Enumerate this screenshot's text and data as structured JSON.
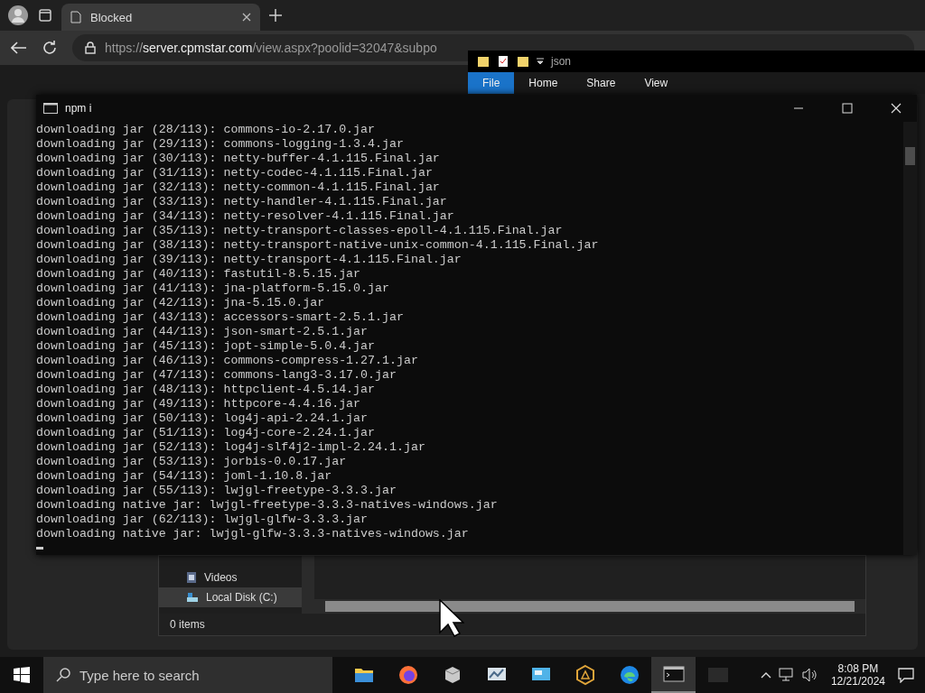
{
  "browser": {
    "tab": {
      "title": "Blocked",
      "selected": true
    },
    "url": {
      "scheme": "https://",
      "host": "server.cpmstar.com",
      "path": "/view.aspx?poolid=32047&subpo"
    }
  },
  "explorer": {
    "path": "json",
    "ribbon_tabs": [
      {
        "label": "File",
        "selected": true
      },
      {
        "label": "Home",
        "selected": false
      },
      {
        "label": "Share",
        "selected": false
      },
      {
        "label": "View",
        "selected": false
      }
    ],
    "nav_items": [
      {
        "label": "Videos",
        "kind": "videos",
        "selected": false
      },
      {
        "label": "Local Disk (C:)",
        "kind": "disk",
        "selected": true
      }
    ],
    "status": "0 items"
  },
  "terminal": {
    "title": "npm i",
    "lines": [
      "downloading jar (28/113): commons-io-2.17.0.jar",
      "downloading jar (29/113): commons-logging-1.3.4.jar",
      "downloading jar (30/113): netty-buffer-4.1.115.Final.jar",
      "downloading jar (31/113): netty-codec-4.1.115.Final.jar",
      "downloading jar (32/113): netty-common-4.1.115.Final.jar",
      "downloading jar (33/113): netty-handler-4.1.115.Final.jar",
      "downloading jar (34/113): netty-resolver-4.1.115.Final.jar",
      "downloading jar (35/113): netty-transport-classes-epoll-4.1.115.Final.jar",
      "downloading jar (38/113): netty-transport-native-unix-common-4.1.115.Final.jar",
      "downloading jar (39/113): netty-transport-4.1.115.Final.jar",
      "downloading jar (40/113): fastutil-8.5.15.jar",
      "downloading jar (41/113): jna-platform-5.15.0.jar",
      "downloading jar (42/113): jna-5.15.0.jar",
      "downloading jar (43/113): accessors-smart-2.5.1.jar",
      "downloading jar (44/113): json-smart-2.5.1.jar",
      "downloading jar (45/113): jopt-simple-5.0.4.jar",
      "downloading jar (46/113): commons-compress-1.27.1.jar",
      "downloading jar (47/113): commons-lang3-3.17.0.jar",
      "downloading jar (48/113): httpclient-4.5.14.jar",
      "downloading jar (49/113): httpcore-4.4.16.jar",
      "downloading jar (50/113): log4j-api-2.24.1.jar",
      "downloading jar (51/113): log4j-core-2.24.1.jar",
      "downloading jar (52/113): log4j-slf4j2-impl-2.24.1.jar",
      "downloading jar (53/113): jorbis-0.0.17.jar",
      "downloading jar (54/113): joml-1.10.8.jar",
      "downloading jar (55/113): lwjgl-freetype-3.3.3.jar",
      "downloading native jar: lwjgl-freetype-3.3.3-natives-windows.jar",
      "downloading jar (62/113): lwjgl-glfw-3.3.3.jar",
      "downloading native jar: lwjgl-glfw-3.3.3-natives-windows.jar"
    ]
  },
  "taskbar": {
    "search_placeholder": "Type here to search",
    "apps": [
      {
        "kind": "folder",
        "selected": false
      },
      {
        "kind": "firefox",
        "selected": false
      },
      {
        "kind": "box",
        "selected": false
      },
      {
        "kind": "chart",
        "selected": false
      },
      {
        "kind": "monitor",
        "selected": false
      },
      {
        "kind": "hexagon",
        "selected": false
      },
      {
        "kind": "edge",
        "selected": false
      },
      {
        "kind": "terminal",
        "selected": true
      },
      {
        "kind": "blank",
        "selected": false
      }
    ],
    "time": "8:08 PM",
    "date": "12/21/2024"
  }
}
